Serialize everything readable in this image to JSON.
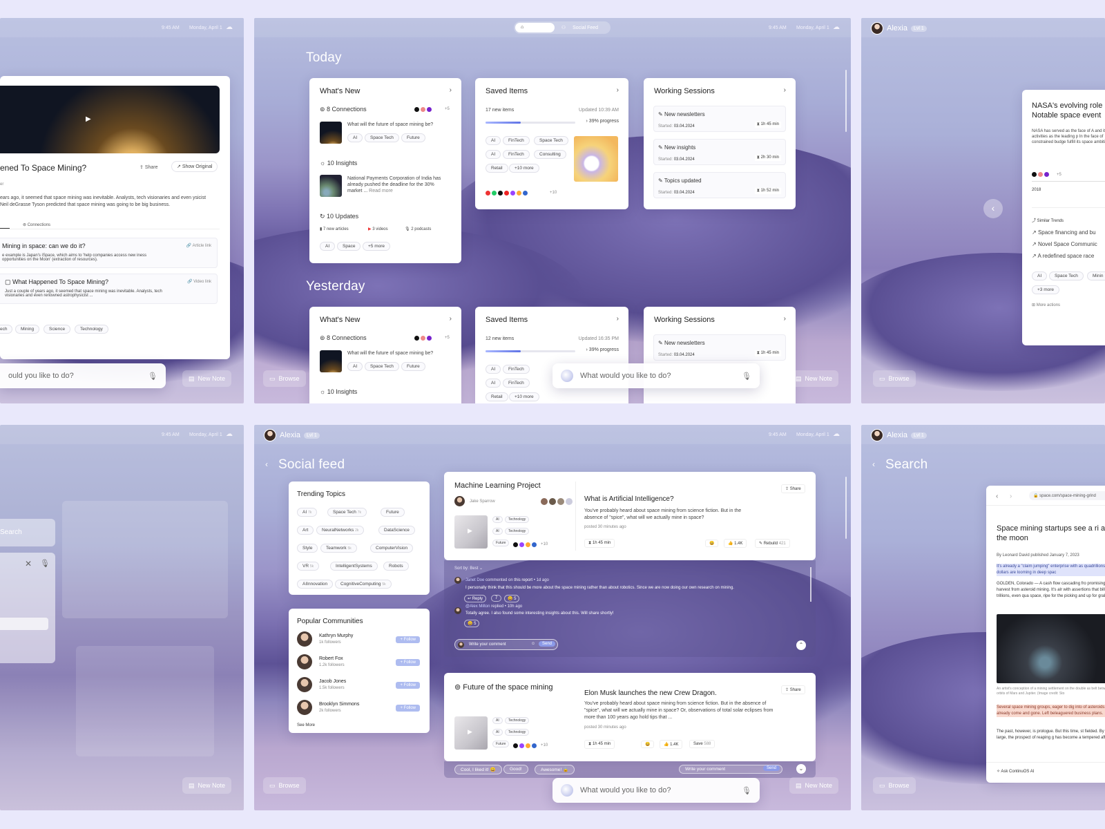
{
  "status": {
    "time": "9:45 AM",
    "date": "Monday, April 1"
  },
  "user": {
    "name": "Alexia",
    "level": "Lvl 1"
  },
  "bottom": {
    "browse": "Browse",
    "new_note": "New Note",
    "prompt": "What would you like to do?",
    "prompt_cut": "ould you like to do?"
  },
  "p1": {
    "title": "ened To Space Mining?",
    "share": "Share",
    "show_original": "Show Original",
    "author_cut": "er",
    "body": "ears ago, it seemed that space mining was inevitable. Analysts, tech visionaries and even ysicist Neil deGrasse Tyson predicted that space mining was going to be big business.",
    "tab_connections": "Connections",
    "items": [
      {
        "title": "Mining in space: can we do it?",
        "link": "Article link",
        "desc": "e example is Japan's iSpace, which aims to 'help companies access new iness opportunities on the Moon' (extraction of resources)."
      },
      {
        "title": "What Happened To Space Mining?",
        "link": "Video link",
        "desc": "Just a couple of years ago, it seemed that space mining was inevitable. Analysts, tech visionaries and even renowned astrophysicist ..."
      }
    ],
    "tags": [
      "ech",
      "Mining",
      "Science",
      "Technology"
    ]
  },
  "p2": {
    "seg": [
      "Home",
      "Social Feed"
    ],
    "today": "Today",
    "yesterday": "Yesterday",
    "whats_new": {
      "title": "What's New",
      "connections": "8 Connections",
      "more": "+5",
      "question": "What will the future of space mining be?",
      "tags": [
        "AI",
        "Space Tech",
        "Future"
      ],
      "insights": "10 Insights",
      "insight_text": "National Payments Corporation of India has already pushed the deadline for the 30% market ...",
      "read_more": "Read more",
      "updates": "10 Updates",
      "articles": "7 new articles",
      "videos": "3 videos",
      "podcasts": "2 podcasts",
      "utags": [
        "AI",
        "Space",
        "+5 more"
      ]
    },
    "saved": {
      "title": "Saved Items",
      "new_today": "17 new items",
      "updated_today": "Updated 10:39 AM",
      "new_y": "12 new items",
      "updated_y": "Updated 16:35 PM",
      "progress": "39% progress",
      "progress_pct": 39,
      "tags": [
        "AI",
        "FinTech",
        "Space Tech",
        "AI",
        "FinTech",
        "Consulting",
        "Retail",
        "+10 more"
      ],
      "more": "+10"
    },
    "work": {
      "title": "Working Sessions",
      "started_label": "Started:",
      "rows": [
        {
          "name": "New newsletters",
          "date": "03.04.2024",
          "dur": "1h 45 min"
        },
        {
          "name": "New insights",
          "date": "03.04.2024",
          "dur": "2h 30 min"
        },
        {
          "name": "Topics updated",
          "date": "03.04.2024",
          "dur": "1h 52 min"
        }
      ],
      "cut_dur": "min"
    }
  },
  "p3": {
    "title": "NASA's evolving role Notable space event",
    "body": "NASA has served as the face of A and its activities as the leading p In the face of constrained budge fulfill its space ambitions.",
    "year": "2018",
    "more": "+5",
    "similar": "Similar Trends",
    "trends": [
      "Space financing and bu",
      "Novel Space Communic",
      "A redefined space race"
    ],
    "tags": [
      "AI",
      "Space Tech",
      "Minin",
      "+3 more"
    ],
    "more_actions": "More actions"
  },
  "p4": {
    "search": "Search"
  },
  "p5": {
    "heading": "Social feed",
    "trending": {
      "title": "Trending Topics",
      "tags": [
        {
          "l": "AI",
          "c": "7k"
        },
        {
          "l": "Space Tech",
          "c": "7k"
        },
        {
          "l": "Future",
          "c": ""
        },
        {
          "l": "Art",
          "c": ""
        },
        {
          "l": "NeuralNetworks",
          "c": "2k"
        },
        {
          "l": "DataScience",
          "c": ""
        },
        {
          "l": "Style",
          "c": ""
        },
        {
          "l": "Teamwork",
          "c": "5k"
        },
        {
          "l": "ComputerVision",
          "c": ""
        },
        {
          "l": "VR",
          "c": "5k"
        },
        {
          "l": "IntelligentSystems",
          "c": ""
        },
        {
          "l": "Robots",
          "c": ""
        },
        {
          "l": "AIInnovation",
          "c": ""
        },
        {
          "l": "CognitiveComputing",
          "c": "5k"
        }
      ]
    },
    "communities": {
      "title": "Popular Communities",
      "follow": "+ Follow",
      "see_more": "See More",
      "people": [
        {
          "n": "Kathryn Murphy",
          "f": "1k followers"
        },
        {
          "n": "Robert Fox",
          "f": "1.2k followers"
        },
        {
          "n": "Jacob Jones",
          "f": "1.5k followers"
        },
        {
          "n": "Brooklyn Simmons",
          "f": "2k followers"
        }
      ]
    },
    "post1": {
      "title": "Machine Learning Project",
      "author": "Jake Sparrow",
      "q": "What is Artificial Intelligence?",
      "body": "You've probably heard about space mining from science fiction. But in the absence of \"spice\", what will we actually mine in space?",
      "posted": "posted 30 minutes ago",
      "dur": "1h 45 min",
      "likes": "1.4K",
      "rebuild": "Rebuild",
      "rebuild_c": "421",
      "share": "Share",
      "tags": [
        "AI",
        "Technology",
        "AI",
        "Technology",
        "Future"
      ],
      "more": "+10"
    },
    "comments": {
      "sort": "Sort by:",
      "sort_v": "Best",
      "c1_author": "Janet Doe",
      "c1_action": "commented on",
      "c1_target": "this report",
      "c1_time": "1d ago",
      "c1_text": "I personally think that this should be more about the space mining rather than about robotics. Since we are now doing our own research on mining.",
      "reply": "Reply",
      "r1": "7",
      "r2": "5",
      "c2_author": "@Alex Milton",
      "c2_action": "replied",
      "c2_time": "10h ago",
      "c2_text": "Totally agree. I also found some interesting insights about this. Will share shortly!",
      "r3": "5",
      "input": "Write your comment",
      "send": "Send"
    },
    "post2": {
      "title": "Future of the space mining",
      "q": "Elon Musk launches the new Crew Dragon.",
      "body": "You've probably heard about space mining from science fiction. But in the absence of \"spice\", what will we actually mine in space? Or, observations of total solar eclipses from more than 100 years ago hold tips that ...",
      "posted": "posted 30 minutes ago",
      "dur": "1h 45 min",
      "likes": "1.4K",
      "save": "Save",
      "save_c": "588",
      "share": "Share",
      "tags": [
        "AI",
        "Technology",
        "AI",
        "Technology",
        "Future"
      ],
      "more": "+10"
    },
    "quick": [
      "Cool, I liked it!",
      "Good!",
      "Awesome!"
    ],
    "input": "Write your comment",
    "send": "Send"
  },
  "p6": {
    "heading": "Search",
    "url": "space.com/space-mining-grind",
    "title": "Space mining startups see a ri and the moon",
    "byline": "By Leonard David published January 7, 2023",
    "lead": "It's already a \"claim jumping\" enterprise with as quadrillions of dollars are looming in deep spac",
    "p1": "GOLDEN, Colorado — A cash flow cascading fro promising harvest from asteroid mining. It's alr with assertions that billions, trillions, even qua space, ripe for the picking and up for grabs.",
    "caption": "An artist's conception of a mining settlement on the double as belt between the orbits of Mars and Jupiter. (Image credit: Sto",
    "hl": "Several space mining groups, eager to dig into of asteroids, have already come and gone. Left beleaguered business plans.",
    "p2": "The past, however, is prologue. But this time, st fielded. By and large, the prospect of reaping g has become a tempered affair.",
    "ask": "Ask ContinuOS AI"
  },
  "colors": {
    "accent": "#5f73e6",
    "highlight_blue": "#dfe3fb",
    "highlight_red": "#f9d9cf"
  }
}
